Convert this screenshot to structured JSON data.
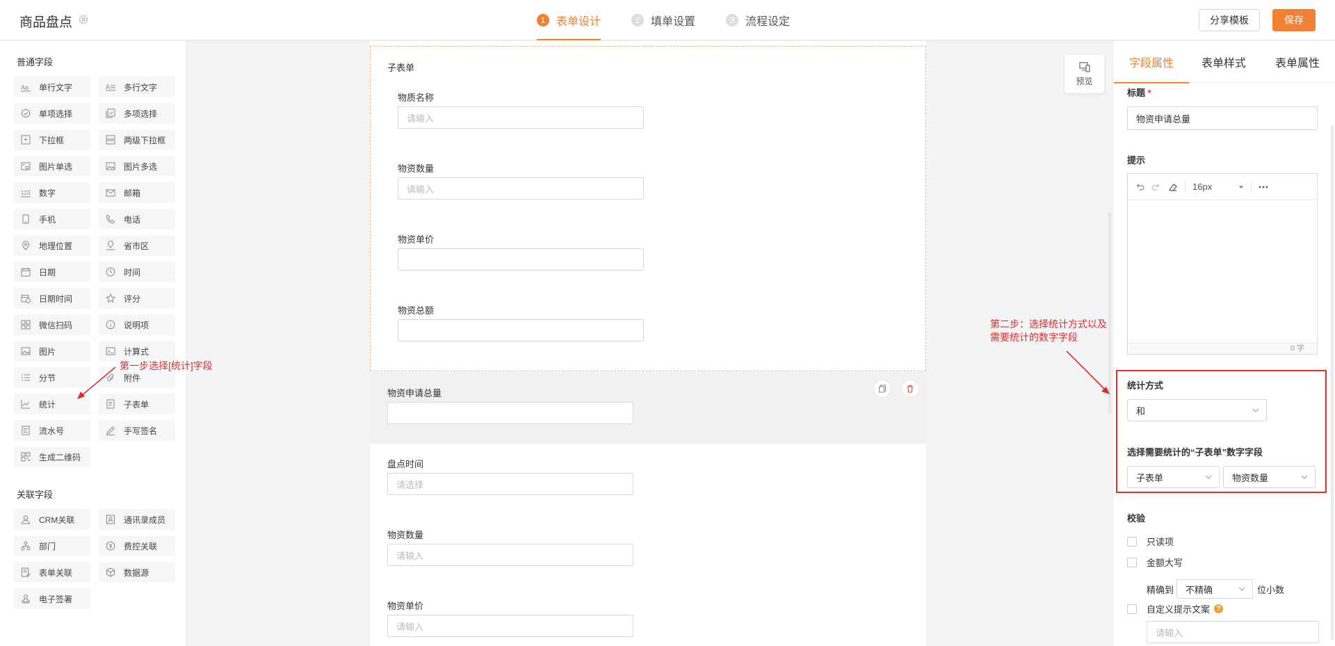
{
  "header": {
    "title": "商品盘点",
    "steps": [
      {
        "num": "1",
        "label": "表单设计"
      },
      {
        "num": "2",
        "label": "填单设置"
      },
      {
        "num": "3",
        "label": "流程设定"
      }
    ],
    "share_label": "分享模板",
    "save_label": "保存"
  },
  "left": {
    "common_title": "普通字段",
    "common": [
      {
        "label": "单行文字",
        "icon": "text-icon"
      },
      {
        "label": "多行文字",
        "icon": "multiline-icon"
      },
      {
        "label": "单项选择",
        "icon": "radio-icon"
      },
      {
        "label": "多项选择",
        "icon": "checkbox-icon"
      },
      {
        "label": "下拉框",
        "icon": "dropdown-icon"
      },
      {
        "label": "两级下拉框",
        "icon": "cascade-icon"
      },
      {
        "label": "图片单选",
        "icon": "image-radio-icon"
      },
      {
        "label": "图片多选",
        "icon": "image-multi-icon"
      },
      {
        "label": "数字",
        "icon": "number-icon"
      },
      {
        "label": "邮箱",
        "icon": "mail-icon"
      },
      {
        "label": "手机",
        "icon": "mobile-icon"
      },
      {
        "label": "电话",
        "icon": "phone-icon"
      },
      {
        "label": "地理位置",
        "icon": "location-icon"
      },
      {
        "label": "省市区",
        "icon": "region-icon"
      },
      {
        "label": "日期",
        "icon": "calendar-icon"
      },
      {
        "label": "时间",
        "icon": "clock-icon"
      },
      {
        "label": "日期时间",
        "icon": "datetime-icon"
      },
      {
        "label": "评分",
        "icon": "star-icon"
      },
      {
        "label": "微信扫码",
        "icon": "qr-scan-icon"
      },
      {
        "label": "说明项",
        "icon": "info-icon"
      },
      {
        "label": "图片",
        "icon": "image-icon"
      },
      {
        "label": "计算式",
        "icon": "formula-icon"
      },
      {
        "label": "分节",
        "icon": "section-icon"
      },
      {
        "label": "附件",
        "icon": "attachment-icon"
      },
      {
        "label": "统计",
        "icon": "chart-icon"
      },
      {
        "label": "子表单",
        "icon": "subform-icon"
      },
      {
        "label": "流水号",
        "icon": "serial-icon"
      },
      {
        "label": "手写签名",
        "icon": "signature-icon"
      },
      {
        "label": "生成二维码",
        "icon": "qrcode-icon"
      }
    ],
    "related_title": "关联字段",
    "related": [
      {
        "label": "CRM关联",
        "icon": "user-icon"
      },
      {
        "label": "通讯录成员",
        "icon": "contact-icon"
      },
      {
        "label": "部门",
        "icon": "org-icon"
      },
      {
        "label": "费控关联",
        "icon": "money-icon"
      },
      {
        "label": "表单关联",
        "icon": "form-link-icon"
      },
      {
        "label": "数据源",
        "icon": "cube-icon"
      },
      {
        "label": "电子签署",
        "icon": "stamp-icon"
      }
    ]
  },
  "canvas": {
    "subform_title": "子表单",
    "subform_fields": [
      {
        "label": "物质名称",
        "placeholder": "请输入"
      },
      {
        "label": "物资数量",
        "placeholder": "请输入"
      },
      {
        "label": "物资单价",
        "placeholder": ""
      },
      {
        "label": "物资总额",
        "placeholder": ""
      }
    ],
    "selected_field_label": "物资申请总量",
    "fields": [
      {
        "label": "盘点时间",
        "placeholder": "请选择"
      },
      {
        "label": "物资数量",
        "placeholder": "请输入"
      },
      {
        "label": "物资单价",
        "placeholder": "请输入"
      }
    ],
    "preview_label": "预览"
  },
  "right": {
    "tabs": [
      "字段属性",
      "表单样式",
      "表单属性"
    ],
    "title_label": "标题",
    "title_required": "*",
    "title_value": "物资申请总量",
    "hint_label": "提示",
    "font_size": "16px",
    "char_count": "0 字",
    "stat_method_label": "统计方式",
    "stat_method_value": "和",
    "stat_field_label": "选择需要统计的“子表单”数字字段",
    "stat_source_value": "子表单",
    "stat_field_value": "物资数量",
    "validate_label": "校验",
    "readonly_label": "只读项",
    "uppercase_label": "金额大写",
    "precision_prefix": "精确到",
    "precision_value": "不精确",
    "precision_suffix": "位小数",
    "custom_hint_label": "自定义提示文案",
    "custom_hint_placeholder": "请输入"
  },
  "annotations": {
    "step1": "第一步选择[统计]字段",
    "step2_line1": "第二步：选择统计方式以及",
    "step2_line2": "需要统计的数字字段"
  },
  "colors": {
    "accent": "#f08132",
    "annotation": "#e02b2b"
  }
}
